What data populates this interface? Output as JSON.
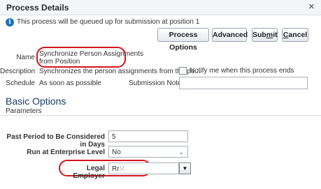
{
  "dialog": {
    "title": "Process Details",
    "close_glyph": "×"
  },
  "info": {
    "icon": "info-icon",
    "glyph": "i",
    "message": "This process will be queued up for submission at position 1"
  },
  "toolbar": {
    "process_options": "Process Options",
    "advanced": "Advanced",
    "submit_pre": "Sub",
    "submit_u": "m",
    "submit_post": "it",
    "cancel_u": "C",
    "cancel_post": "ancel"
  },
  "details": {
    "name_label": "Name",
    "name_line1": "Synchronize Person Assignments",
    "name_line2": "from Position",
    "description_label": "Description",
    "description_value": "Synchronizes the person assignments from the po...",
    "notify_label": "Notify me when this process ends",
    "notify_checked": false,
    "schedule_label": "Schedule",
    "schedule_value": "As soon as possible",
    "submission_notes_label": "Submission Notes",
    "submission_notes_value": ""
  },
  "basic_options": {
    "section_title": "Basic Options",
    "parameters_label": "Parameters",
    "past_period_label": "Past Period to Be Considered in Days",
    "past_period_value": "5",
    "run_enterprise_label": "Run at Enterprise Level",
    "run_enterprise_value": "No",
    "legal_employer_label": "Legal Employer",
    "legal_employer_value": "Rr⁙"
  },
  "colors": {
    "highlight": "#d4141c",
    "section_title": "#1a3a66",
    "info_icon": "#1e73be"
  }
}
